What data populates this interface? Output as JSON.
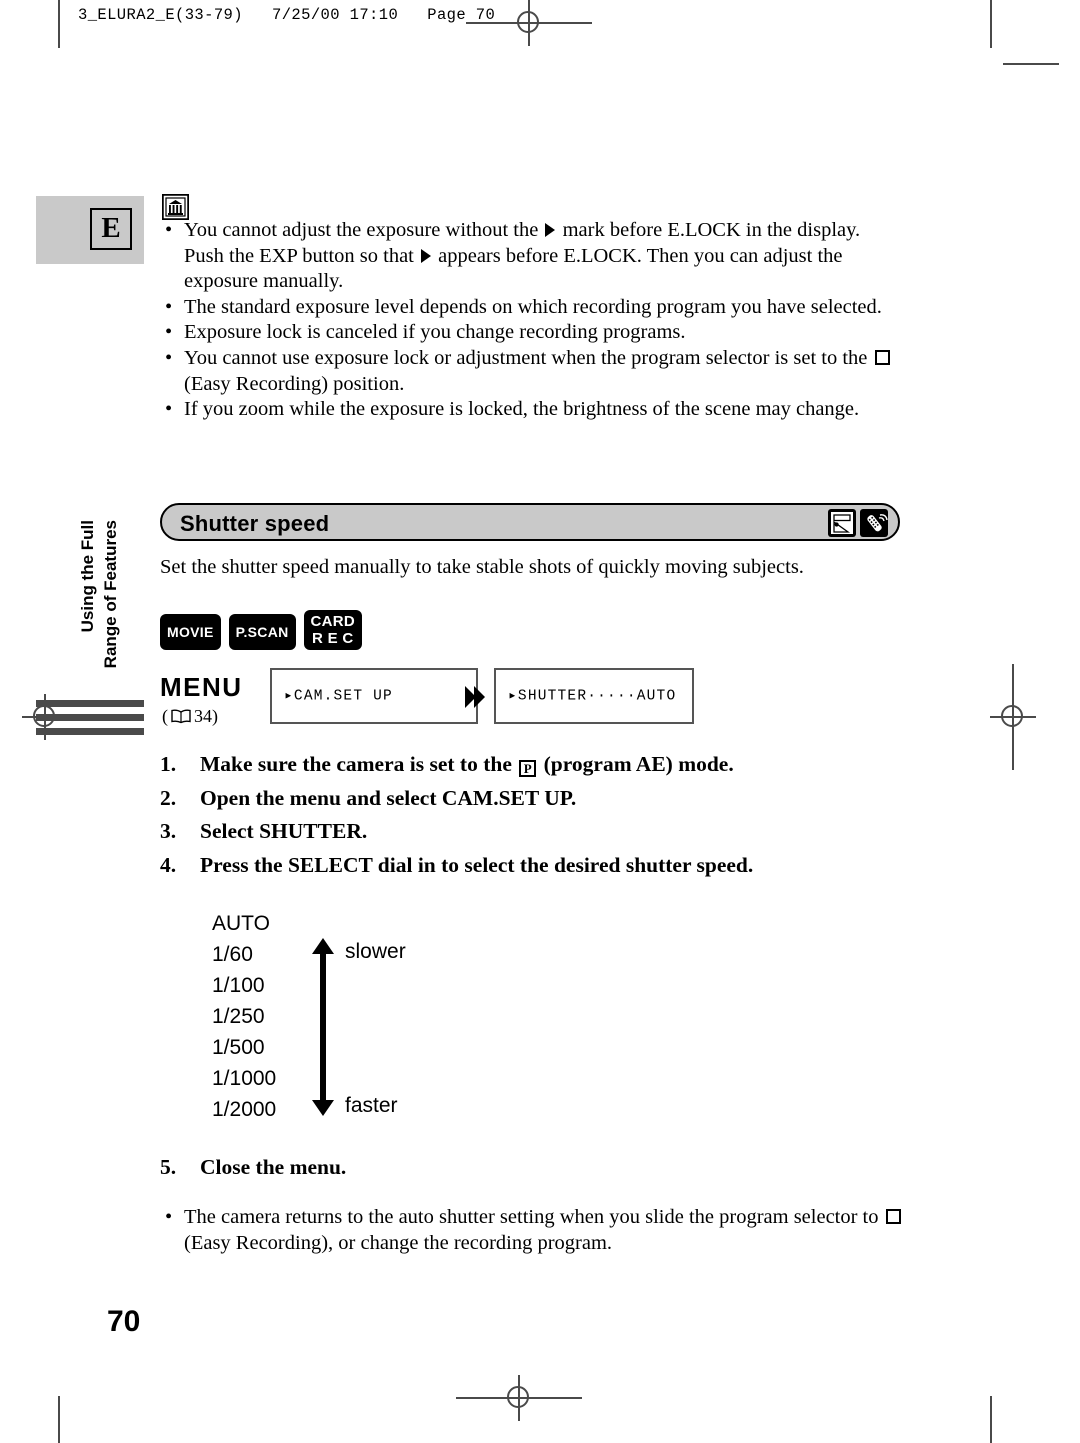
{
  "print_slug": "3_ELURA2_E(33-79)   7/25/00 17:10   Page 70",
  "chapter_tab": {
    "letter": "E"
  },
  "side_tab": {
    "line1": "Using the Full",
    "line2": "Range of Features"
  },
  "notes": {
    "icon": "note-icon",
    "bullets": [
      {
        "parts": [
          {
            "t": "text",
            "v": "You cannot adjust the exposure without the "
          },
          {
            "t": "icon",
            "v": "triangle-right-glyph"
          },
          {
            "t": "text",
            "v": " mark before E.LOCK in the display. Push the EXP button so that "
          },
          {
            "t": "icon",
            "v": "triangle-right-glyph"
          },
          {
            "t": "text",
            "v": " appears before E.LOCK. Then you can adjust the exposure manually."
          }
        ]
      },
      {
        "parts": [
          {
            "t": "text",
            "v": "The standard exposure level depends on which recording program you have selected."
          }
        ]
      },
      {
        "parts": [
          {
            "t": "text",
            "v": "Exposure lock is canceled if you change recording programs."
          }
        ]
      },
      {
        "parts": [
          {
            "t": "text",
            "v": "You cannot use exposure lock or adjustment when the program selector is set to the "
          },
          {
            "t": "icon",
            "v": "square-glyph"
          },
          {
            "t": "text",
            "v": " (Easy Recording) position."
          }
        ]
      },
      {
        "parts": [
          {
            "t": "text",
            "v": "If you zoom while the exposure is locked, the brightness of the scene may change."
          }
        ]
      }
    ]
  },
  "section": {
    "title": "Shutter speed",
    "badges": [
      "camera-viewfinder-icon",
      "wireless-remote-icon"
    ],
    "intro": "Set the shutter speed manually to take stable shots of quickly moving subjects."
  },
  "mode_badges": [
    {
      "label": "MOVIE",
      "lines": [
        "MOVIE"
      ]
    },
    {
      "label": "P.SCAN",
      "lines": [
        "P.SCAN"
      ]
    },
    {
      "label": "CARD REC",
      "lines": [
        "CARD",
        "R E C"
      ]
    }
  ],
  "menu": {
    "word": "MENU",
    "ref_prefix": "(",
    "ref_page": "34",
    "ref_suffix": ")",
    "book_icon": "open-book-icon",
    "chevron_icon": "double-chevron-right-icon",
    "lcd1": "▸CAM.SET UP",
    "lcd2": "▸SHUTTER·····AUTO"
  },
  "steps": [
    {
      "num": "1.",
      "parts": [
        {
          "t": "text",
          "v": "Make sure the camera is set to the "
        },
        {
          "t": "icon",
          "v": "program-ae-p-glyph"
        },
        {
          "t": "text",
          "v": " (program AE) mode."
        }
      ]
    },
    {
      "num": "2.",
      "parts": [
        {
          "t": "text",
          "v": "Open the menu and select CAM.SET UP."
        }
      ]
    },
    {
      "num": "3.",
      "parts": [
        {
          "t": "text",
          "v": "Select SHUTTER."
        }
      ]
    },
    {
      "num": "4.",
      "parts": [
        {
          "t": "text",
          "v": "Press the SELECT dial in to select the desired shutter speed."
        }
      ]
    }
  ],
  "shutter_speeds": {
    "values": [
      "AUTO",
      "1/60",
      "1/100",
      "1/250",
      "1/500",
      "1/1000",
      "1/2000"
    ],
    "label_top": "slower",
    "label_bottom": "faster",
    "arrow_icon": "double-headed-vertical-arrow-icon"
  },
  "step5": {
    "num": "5.",
    "text": "Close the menu."
  },
  "closing_bullets": [
    {
      "parts": [
        {
          "t": "text",
          "v": "The camera returns to the auto shutter setting when you slide the program selector to "
        },
        {
          "t": "icon",
          "v": "square-glyph"
        },
        {
          "t": "text",
          "v": " (Easy Recording), or change the recording program."
        }
      ]
    }
  ],
  "page_number": "70",
  "colors": {
    "tab_gray": "#c9c9c9",
    "bar_gray": "#4a4a4a",
    "ink": "#000000"
  }
}
